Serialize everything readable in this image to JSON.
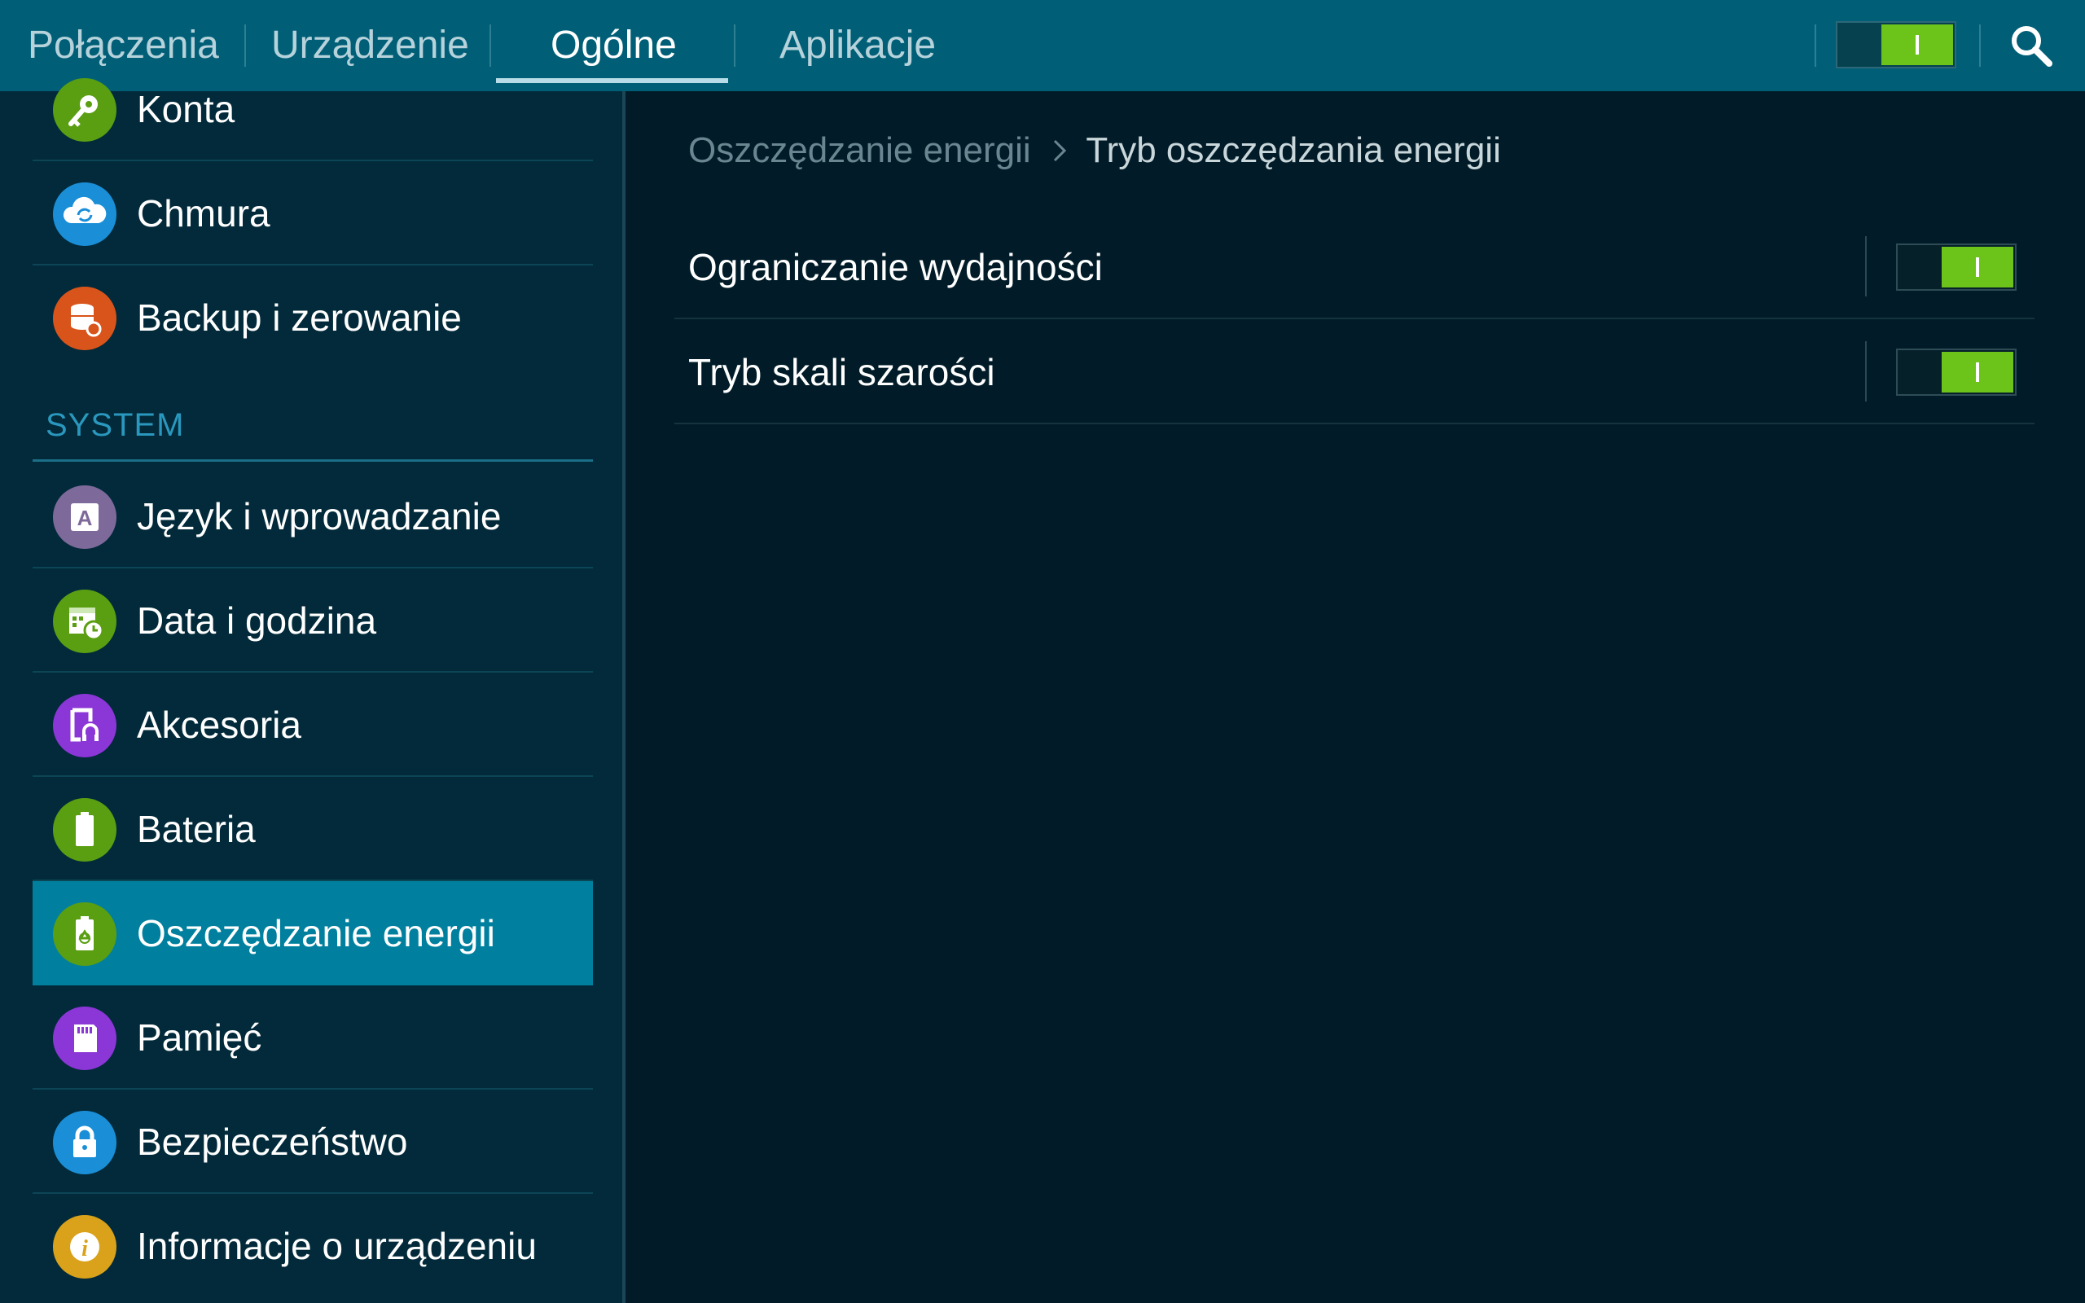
{
  "tabs": [
    {
      "label": "Połączenia",
      "active": false
    },
    {
      "label": "Urządzenie",
      "active": false
    },
    {
      "label": "Ogólne",
      "active": true
    },
    {
      "label": "Aplikacje",
      "active": false
    }
  ],
  "master_switch": {
    "on": true
  },
  "colors": {
    "topbar": "#005f77",
    "left_panel": "#022a3a",
    "right_panel": "#011c28",
    "selected_item": "#00809e",
    "toggle_on": "#6cc319",
    "section_header": "#2a98be"
  },
  "sidebar": {
    "items_top": [
      {
        "label": "Konta",
        "icon": "key-icon",
        "color": "#5a9e12"
      },
      {
        "label": "Chmura",
        "icon": "cloud-sync-icon",
        "color": "#1a8fd8"
      },
      {
        "label": "Backup i zerowanie",
        "icon": "backup-database-icon",
        "color": "#d9541a"
      }
    ],
    "section_title": "SYSTEM",
    "items_system": [
      {
        "label": "Język i wprowadzanie",
        "icon": "keyboard-a-icon",
        "color": "#7e6a9a"
      },
      {
        "label": "Data i godzina",
        "icon": "calendar-clock-icon",
        "color": "#5a9e12"
      },
      {
        "label": "Akcesoria",
        "icon": "accessory-icon",
        "color": "#8b36d6"
      },
      {
        "label": "Bateria",
        "icon": "battery-icon",
        "color": "#5a9e12"
      },
      {
        "label": "Oszczędzanie energii",
        "icon": "power-saving-battery-icon",
        "color": "#5a9e12",
        "selected": true
      },
      {
        "label": "Pamięć",
        "icon": "sd-card-icon",
        "color": "#8b36d6"
      },
      {
        "label": "Bezpieczeństwo",
        "icon": "lock-icon",
        "color": "#1a8fd8"
      },
      {
        "label": "Informacje o urządzeniu",
        "icon": "info-icon",
        "color": "#d9a21a"
      }
    ]
  },
  "breadcrumb": {
    "parent": "Oszczędzanie energii",
    "current": "Tryb oszczędzania energii"
  },
  "settings": [
    {
      "label": "Ograniczanie wydajności",
      "enabled": true
    },
    {
      "label": "Tryb skali szarości",
      "enabled": true
    }
  ]
}
